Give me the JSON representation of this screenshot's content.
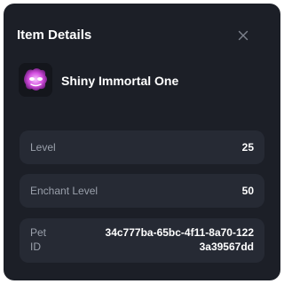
{
  "modal": {
    "title": "Item Details",
    "close_icon": "close-icon"
  },
  "item": {
    "name": "Shiny Immortal One",
    "icon": "pet-icon",
    "icon_color": "#c43fd4"
  },
  "stats": [
    {
      "label": "Level",
      "value": "25"
    },
    {
      "label": "Enchant Level",
      "value": "50"
    },
    {
      "label": "Pet ID",
      "value": "34c777ba-65bc-4f11-8a70-1223a39567dd"
    }
  ],
  "colors": {
    "background": "#1c1f27",
    "card": "#262a34",
    "label": "#9aa0ab",
    "text": "#ffffff"
  }
}
